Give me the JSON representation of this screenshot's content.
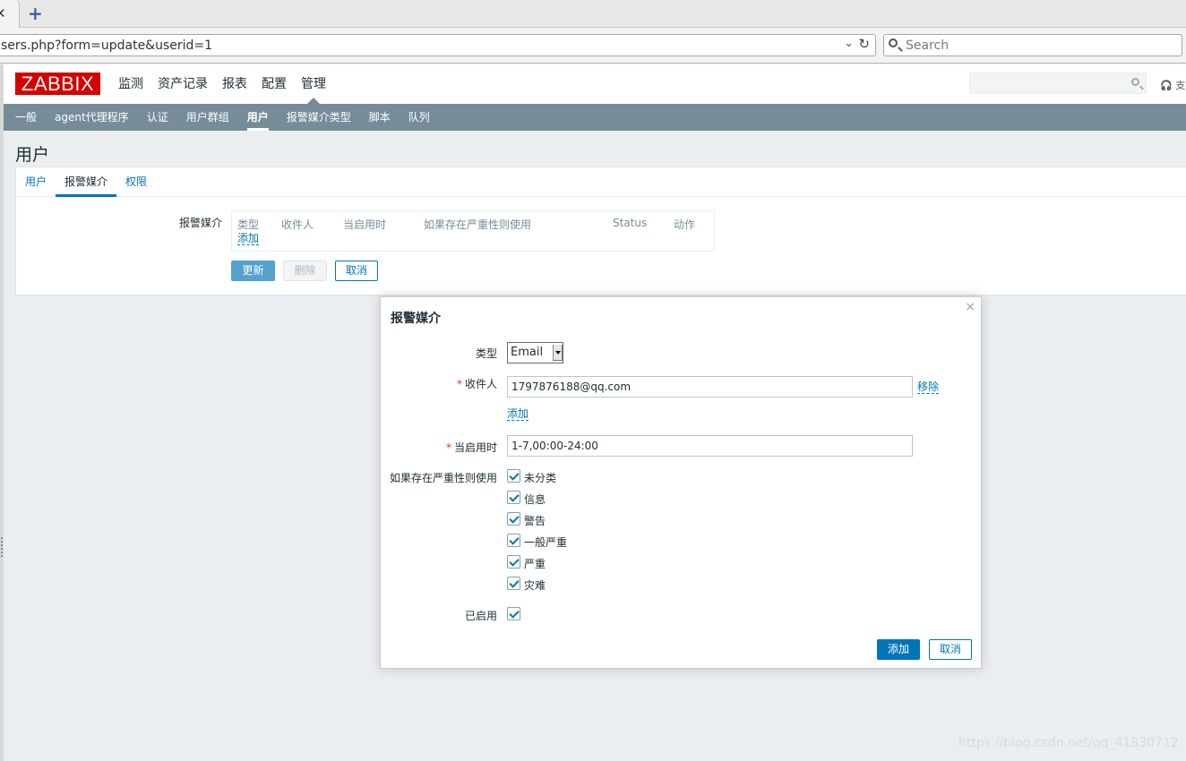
{
  "browser": {
    "url": "sers.php?form=update&userid=1",
    "search_placeholder": "Search",
    "tab_close": "✕",
    "new_tab": "+",
    "url_dropdown": "⌄",
    "reload": "↻"
  },
  "header": {
    "logo": "ZABBIX",
    "main_menu": [
      "监测",
      "资产记录",
      "报表",
      "配置",
      "管理"
    ],
    "active_main": "管理",
    "support_text": "支持"
  },
  "sub_menu": {
    "items": [
      "一般",
      "agent代理程序",
      "认证",
      "用户群组",
      "用户",
      "报警媒介类型",
      "脚本",
      "队列"
    ],
    "active": "用户"
  },
  "page": {
    "title": "用户",
    "tabs": [
      "用户",
      "报警媒介",
      "权限"
    ],
    "active_tab": "报警媒介",
    "media_label": "报警媒介",
    "media_table": {
      "columns": [
        "类型",
        "收件人",
        "当启用时",
        "如果存在严重性则使用",
        "Status",
        "动作"
      ],
      "add_link": "添加"
    },
    "buttons": {
      "update": "更新",
      "delete": "删除",
      "cancel": "取消"
    }
  },
  "modal": {
    "title": "报警媒介",
    "close": "×",
    "type_label": "类型",
    "type_value": "Email",
    "sendto_label": "收件人",
    "sendto_value": "1797876188@qq.com",
    "remove_link": "移除",
    "add_link": "添加",
    "period_label": "当启用时",
    "period_value": "1-7,00:00-24:00",
    "severity_label": "如果存在严重性则使用",
    "severities": [
      {
        "label": "未分类",
        "checked": true
      },
      {
        "label": "信息",
        "checked": true
      },
      {
        "label": "警告",
        "checked": true
      },
      {
        "label": "一般严重",
        "checked": true
      },
      {
        "label": "严重",
        "checked": true
      },
      {
        "label": "灾难",
        "checked": true
      }
    ],
    "enabled_label": "已启用",
    "enabled": true,
    "add_button": "添加",
    "cancel_button": "取消"
  },
  "watermark": "https://blog.csdn.net/qq_41830712",
  "colors": {
    "brand_red": "#d40000",
    "submenu_bg": "#768d99",
    "link_blue": "#0275b8",
    "required": "#e33734"
  }
}
